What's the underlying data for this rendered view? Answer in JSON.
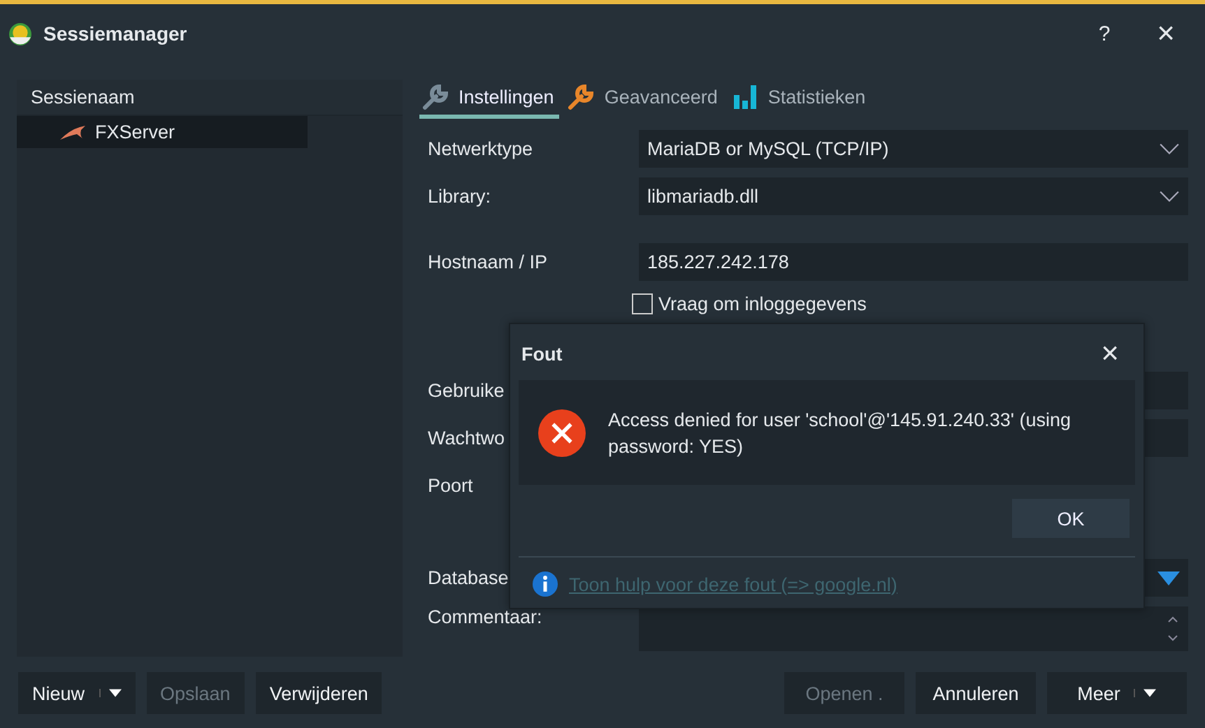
{
  "window": {
    "title": "Sessiemanager",
    "help": "?",
    "close": "×"
  },
  "sessions": {
    "header": "Sessienaam",
    "items": [
      {
        "label": "FXServer",
        "selected": true
      }
    ]
  },
  "tabs": [
    {
      "label": "Instellingen",
      "selected": true,
      "kind": "wrench"
    },
    {
      "label": "Geavanceerd",
      "selected": false,
      "kind": "wrench-orange"
    },
    {
      "label": "Statistieken",
      "selected": false,
      "kind": "chart"
    }
  ],
  "form": [
    {
      "kind": "select",
      "label": "Netwerktype",
      "value": "MariaDB or MySQL (TCP/IP)"
    },
    {
      "kind": "select",
      "label": "Library:",
      "value": "libmariadb.dll"
    },
    {
      "kind": "gap"
    },
    {
      "kind": "text",
      "label": "Hostnaam / IP",
      "value": "185.227.242.178"
    },
    {
      "kind": "checkbox",
      "label": "Vraag om inloggegevens",
      "checked": false
    },
    {
      "kind": "gap"
    },
    {
      "kind": "text",
      "label": "Gebruike"
    },
    {
      "kind": "text",
      "label": "Wachtwo"
    },
    {
      "kind": "plain",
      "label": "Poort"
    },
    {
      "kind": "gap"
    },
    {
      "kind": "dbselect",
      "label": "Database"
    },
    {
      "kind": "memo",
      "label": "Commentaar:"
    }
  ],
  "left_buttons": [
    {
      "label": "Nieuw",
      "disabled": false,
      "split": true
    },
    {
      "label": "Opslaan",
      "disabled": true,
      "split": false
    },
    {
      "label": "Verwijderen",
      "disabled": false,
      "split": false
    }
  ],
  "right_buttons": [
    {
      "label": "Openen .",
      "disabled": true,
      "split": false
    },
    {
      "label": "Annuleren",
      "disabled": false,
      "split": false
    },
    {
      "label": "Meer",
      "disabled": false,
      "split": true
    }
  ],
  "dialog": {
    "title": "Fout",
    "close": "×",
    "message": "Access denied for user 'school'@'145.91.240.33' (using password: YES)",
    "ok": "OK",
    "help_link": "Toon hulp voor deze fout (=> google.nl)"
  }
}
